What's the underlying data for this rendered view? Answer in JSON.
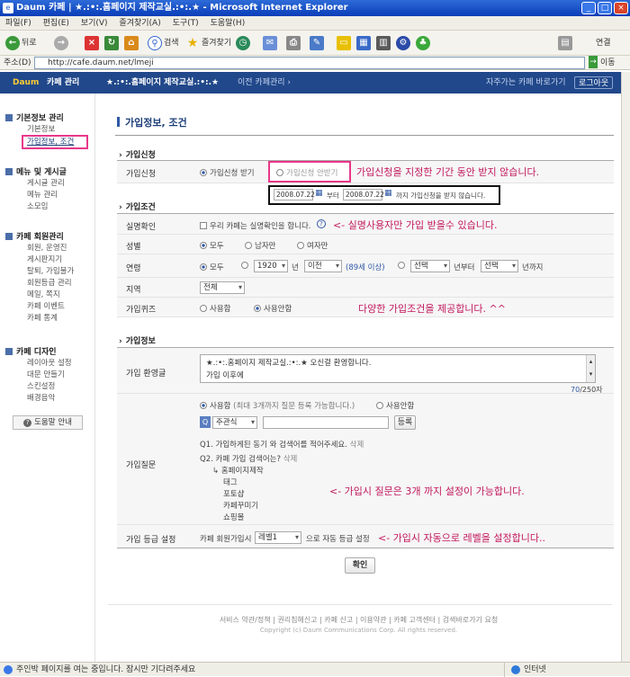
{
  "window": {
    "title": "Daum 카페 | ★.:•:.홈페이지 제작교실.:•:.★ - Microsoft Internet Explorer"
  },
  "menu": [
    "파일(F)",
    "편집(E)",
    "보기(V)",
    "즐겨찾기(A)",
    "도구(T)",
    "도움말(H)"
  ],
  "toolbar": {
    "back": "뒤로",
    "search": "검색",
    "favorites": "즐겨찾기",
    "links": "연결"
  },
  "address": {
    "label": "주소(D)",
    "url": "http://cafe.daum.net/lmeji",
    "go": "이동"
  },
  "cafe_header": {
    "logo": "Daum",
    "title": "카페 관리",
    "cafe_name": "★.:•:.홈페이지 제작교실.:•:.★",
    "prev": "이전 카페관리 ›",
    "fav": "자주가는 카페 바로가기",
    "logout": "로그아웃"
  },
  "nav": {
    "basic": {
      "title": "기본정보 관리",
      "items": [
        "기본정보",
        "가입정보, 조건"
      ]
    },
    "menu": {
      "title": "메뉴 및 게시글",
      "items": [
        "게시글 관리",
        "메뉴 관리",
        "소모임"
      ]
    },
    "member": {
      "title": "카페 회원관리",
      "items": [
        "회원, 운영진",
        "게시판지기",
        "탈퇴, 가입불가",
        "회원등급 관리",
        "메일, 쪽지",
        "카페 이벤트",
        "카페 통계"
      ]
    },
    "design": {
      "title": "카페 디자인",
      "items": [
        "레이아웃 설정",
        "대문 만들기",
        "스킨설정",
        "배경음악"
      ]
    },
    "help": "도움말 안내"
  },
  "page": {
    "title": "가입정보, 조건"
  },
  "sec_apply": "가입신청",
  "apply": {
    "label": "가입신청",
    "opt_on": "가입신청 받기",
    "opt_off": "가입신청 안받기",
    "note": "가입신청을 지정한 기간 동안 받지 않습니다."
  },
  "sec_cond": "가입조건",
  "period": {
    "from": "2008.07.22",
    "from_suffix": "부터",
    "to": "2008.07.22",
    "to_suffix": "까지 가입신청을 받지 않습니다."
  },
  "realname": {
    "label": "실명확인",
    "check": "우리 카페는 실명확인을 합니다.",
    "note": "<- 실명사용자만 가입 받을수 있습니다."
  },
  "gender": {
    "label": "성별",
    "opts": [
      "모두",
      "남자만",
      "여자만"
    ]
  },
  "age": {
    "label": "연령",
    "opt_all": "모두",
    "year": "1920",
    "year_sfx": "년",
    "cmp": "이전",
    "hint": "(89세 이상)",
    "sel1": "선택",
    "sel1_sfx": "년부터",
    "sel2": "선택",
    "sel2_sfx": "년까지"
  },
  "region": {
    "label": "지역",
    "value": "전체"
  },
  "quiz": {
    "label": "가입퀴즈",
    "opt_use": "사용함",
    "opt_none": "사용안함"
  },
  "cond_note": "다양한 가입조건을 제공합니다. ^^",
  "sec_info": "가입정보",
  "welcome": {
    "label": "가입 환영글",
    "line1": "★.:•:.홈페이지 제작교실.:•:.★ 오신걸 환영합니다.",
    "line2": "가입 이후에",
    "count": "70",
    "max": "/250자"
  },
  "question": {
    "label": "가입질문",
    "opt_use": "사용함",
    "opt_use_hint": "(최대 3개까지 질문 등록 가능합니다.)",
    "opt_none": "사용안함",
    "type": "주관식",
    "register": "등록",
    "q1": "Q1. 가입하게된 동기 와 검색어를 적어주세요.",
    "q1_del": "삭제",
    "q2": "Q2. 카페 가입 검색어는?",
    "q2_del": "삭제",
    "answers": [
      "↳ 홈페이지제작",
      "태그",
      "포토샵",
      "카페꾸미기",
      "쇼핑몰"
    ],
    "note": "<- 가입시 질문은 3개 까지 설정이 가능합니다."
  },
  "grade": {
    "label": "가입 등급 설정",
    "text1": "카페 회원가입시",
    "level": "레벨1",
    "text2": "으로 자동 등급 설정",
    "note": "<- 가입시 자동으로 레벨을 설정합니다.."
  },
  "confirm": "확인",
  "footer": {
    "links": "서비스 약관/정책 | 권리침해신고 | 카페 신고 | 이용약관 | 카페 고객센터 | 검색바로가기 요청",
    "copy": "Copyright (c) Daum Communications Corp. All rights reserved."
  },
  "status": {
    "text": "주인박 페이지를 여는 중입니다. 잠시만 기다려주세요",
    "zone": "인터넷"
  }
}
